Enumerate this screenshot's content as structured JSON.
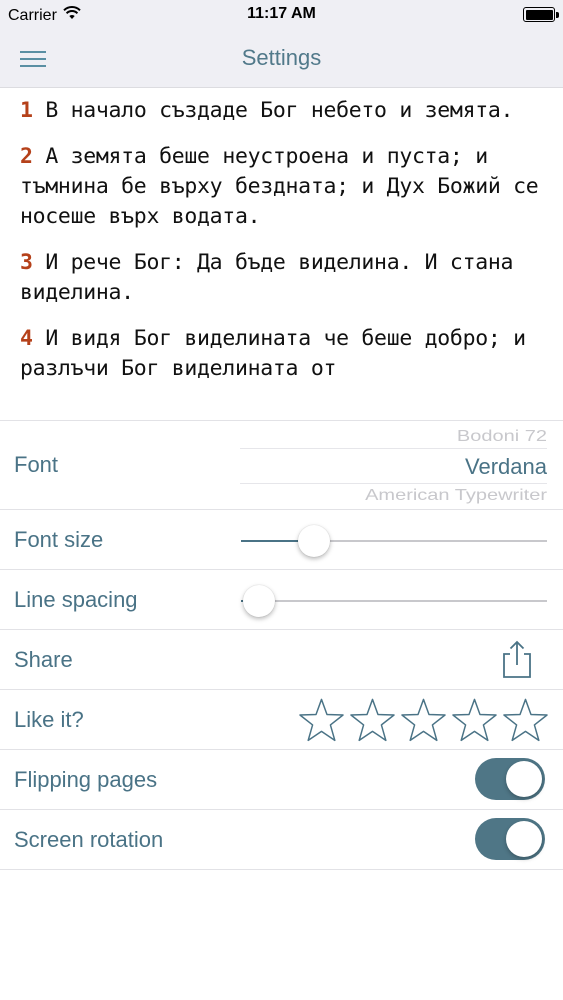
{
  "status_bar": {
    "carrier": "Carrier",
    "time": "11:17 AM",
    "wifi_icon": "wifi-icon",
    "battery_level": 1.0
  },
  "nav": {
    "title": "Settings",
    "menu_icon": "hamburger-menu-icon"
  },
  "verses": [
    {
      "num": "1",
      "text": "В начало създаде Бог небето и земята."
    },
    {
      "num": "2",
      "text": "А земята беше неустроена и пуста; и тъмнина бе върху бездната; и Дух Божий се носеше върх водата."
    },
    {
      "num": "3",
      "text": "И рече Бог: Да бъде виделина. И стана виделина."
    },
    {
      "num": "4",
      "text": "И видя Бог виделината че беше добро; и разлъчи Бог виделината от"
    }
  ],
  "settings": {
    "font": {
      "label": "Font",
      "options": [
        "Bodoni 72",
        "Verdana",
        "American Typewriter"
      ],
      "selected": "Verdana"
    },
    "font_size": {
      "label": "Font size",
      "value": 0.24
    },
    "line_spacing": {
      "label": "Line spacing",
      "value": 0.06
    },
    "share": {
      "label": "Share",
      "icon": "share-icon"
    },
    "like": {
      "label": "Like it?",
      "rating": 0,
      "max": 5,
      "icon": "star-outline-icon"
    },
    "flipping_pages": {
      "label": "Flipping pages",
      "on": true
    },
    "screen_rotation": {
      "label": "Screen rotation",
      "on": true
    }
  },
  "colors": {
    "accent": "#4a7386",
    "verse_number": "#b5411a",
    "toggle_on": "#4f7686",
    "bar_background": "#efeff4"
  }
}
